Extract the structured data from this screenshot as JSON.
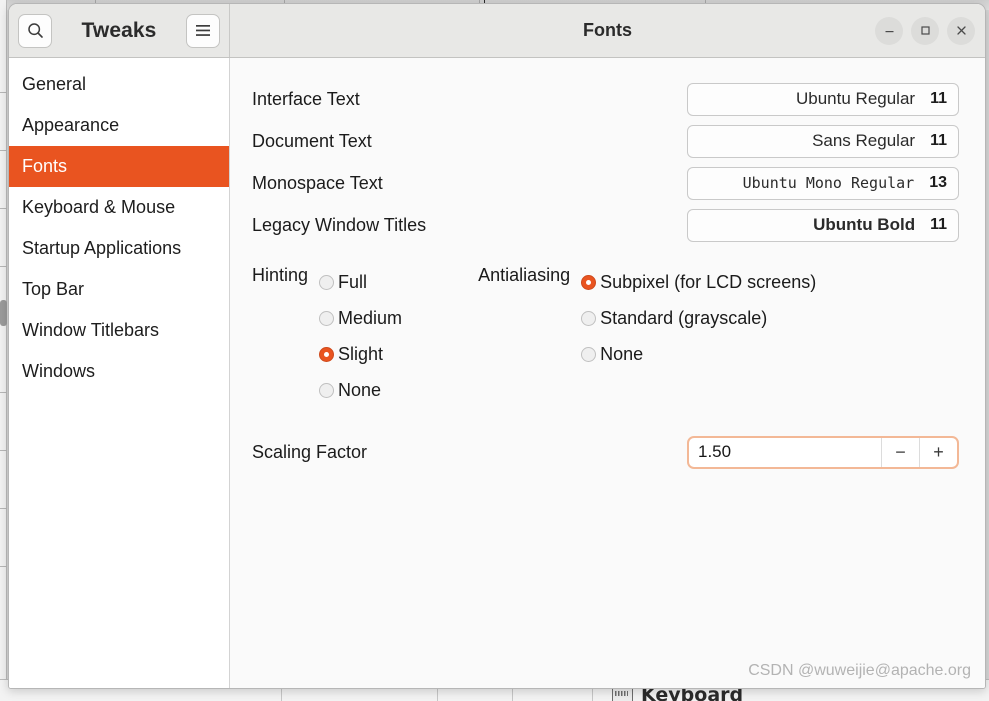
{
  "window": {
    "app_title": "Tweaks",
    "page_title": "Fonts",
    "search_icon": "search-icon",
    "menu_icon": "hamburger-menu-icon",
    "controls": {
      "minimize": "–",
      "maximize": "□",
      "close": "×"
    }
  },
  "sidebar": {
    "items": [
      {
        "label": "General",
        "active": false
      },
      {
        "label": "Appearance",
        "active": false
      },
      {
        "label": "Fonts",
        "active": true
      },
      {
        "label": "Keyboard & Mouse",
        "active": false
      },
      {
        "label": "Startup Applications",
        "active": false
      },
      {
        "label": "Top Bar",
        "active": false
      },
      {
        "label": "Window Titlebars",
        "active": false
      },
      {
        "label": "Windows",
        "active": false
      }
    ]
  },
  "fonts": [
    {
      "label": "Interface Text",
      "value": "Ubuntu Regular",
      "size": "11",
      "style": "regular"
    },
    {
      "label": "Document Text",
      "value": "Sans Regular",
      "size": "11",
      "style": "regular"
    },
    {
      "label": "Monospace Text",
      "value": "Ubuntu Mono Regular",
      "size": "13",
      "style": "mono"
    },
    {
      "label": "Legacy Window Titles",
      "value": "Ubuntu Bold",
      "size": "11",
      "style": "bold"
    }
  ],
  "hinting": {
    "title": "Hinting",
    "options": [
      {
        "label": "Full",
        "selected": false
      },
      {
        "label": "Medium",
        "selected": false
      },
      {
        "label": "Slight",
        "selected": true
      },
      {
        "label": "None",
        "selected": false
      }
    ]
  },
  "antialiasing": {
    "title": "Antialiasing",
    "options": [
      {
        "label": "Subpixel (for LCD screens)",
        "selected": true
      },
      {
        "label": "Standard (grayscale)",
        "selected": false
      },
      {
        "label": "None",
        "selected": false
      }
    ]
  },
  "scaling": {
    "label": "Scaling Factor",
    "value": "1.50",
    "decrement": "−",
    "increment": "+"
  },
  "watermark": "CSDN @wuweijie@apache.org",
  "background": {
    "keyboard_label": "Keyboard"
  },
  "colors": {
    "accent": "#e95420",
    "headerbar": "#e8e8e6",
    "sidebar": "#ffffff",
    "content": "#fafafa",
    "spinner_border": "#f3b896"
  }
}
